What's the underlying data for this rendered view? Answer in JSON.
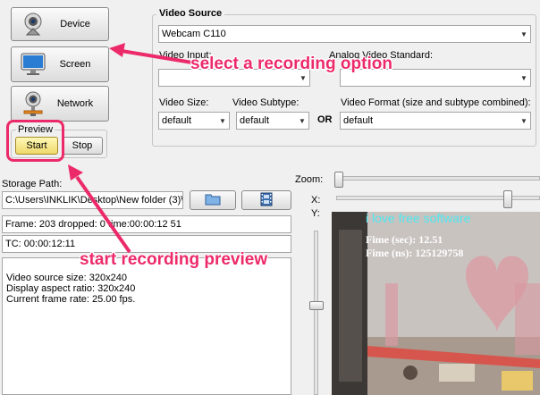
{
  "sources": [
    {
      "label": "Device",
      "icon": "webcam-icon"
    },
    {
      "label": "Screen",
      "icon": "monitor-icon"
    },
    {
      "label": "Network",
      "icon": "network-webcam-icon"
    }
  ],
  "preview": {
    "title": "Preview",
    "start_label": "Start",
    "stop_label": "Stop"
  },
  "video_source": {
    "title": "Video Source",
    "device": "Webcam C110",
    "input_label": "Video Input:",
    "input_value": "",
    "standard_label": "Analog Video Standard:",
    "standard_value": "",
    "size_label": "Video Size:",
    "size_value": "default",
    "subtype_label": "Video Subtype:",
    "subtype_value": "default",
    "or_label": "OR",
    "format_label": "Video Format (size and subtype combined):",
    "format_value": "default"
  },
  "storage": {
    "label": "Storage Path:",
    "path": "C:\\Users\\INKLIK\\Desktop\\New folder (3)\\",
    "browse_icon": "folder-icon",
    "film_icon": "film-icon"
  },
  "status": {
    "frame": "Frame: 203 dropped: 0 time:00:00:12 51",
    "tc": "TC: 00:00:12:11",
    "info_lines": [
      "Video source size: 320x240",
      "Display aspect ratio: 320x240",
      "Current frame rate: 25.00 fps."
    ]
  },
  "controls": {
    "zoom_label": "Zoom:",
    "x_label": "X:",
    "y_label": "Y:"
  },
  "video": {
    "overlay_title": "i love free software",
    "time_sec": "Fime (sec): 12.51",
    "time_ns": "Fime (ns): 125129758"
  },
  "annotations": {
    "select": "select a recording option",
    "start": "start recording preview"
  },
  "colors": {
    "annotation": "#ec2a6a",
    "overlay_title": "#4fe8f0",
    "overlay_text": "#ffffff"
  }
}
